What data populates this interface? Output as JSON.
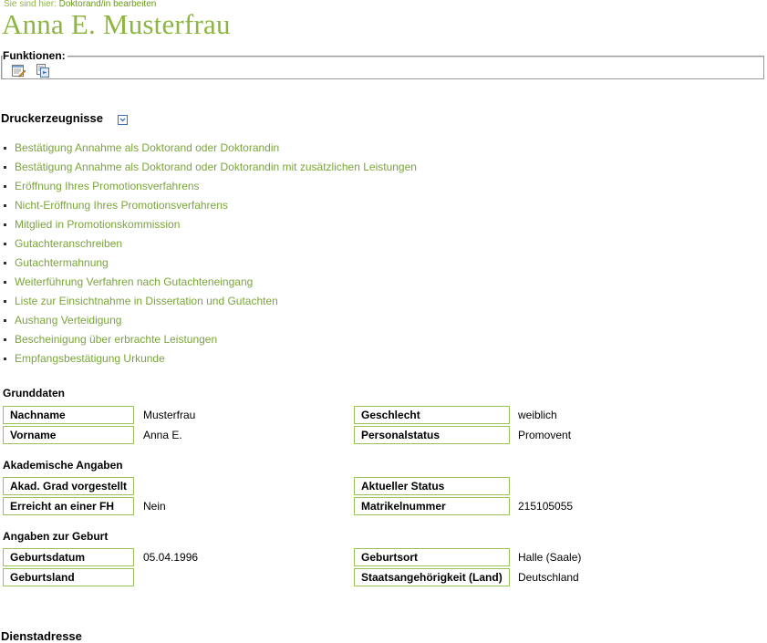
{
  "breadcrumb": {
    "prefix": "Sie sind hier:",
    "current": "Doktorand/in bearbeiten"
  },
  "page_title": "Anna E. Musterfrau",
  "functions": {
    "label": "Funktionen:",
    "icons": [
      "edit-document-icon",
      "document-view-icon"
    ]
  },
  "prints": {
    "title": "Druckerzeugnisse",
    "toggle_icon": "chevron-down-icon",
    "items": [
      "Bestätigung Annahme als Doktorand oder Doktorandin",
      "Bestätigung Annahme als Doktorand oder Doktorandin mit zusätzlichen Leistungen",
      "Eröffnung Ihres Promotionsverfahrens",
      "Nicht-Eröffnung Ihres Promotionsverfahrens",
      "Mitglied in Promotionskommission",
      "Gutachteranschreiben",
      "Gutachtermahnung",
      "Weiterführung Verfahren nach Gutachteneingang",
      "Liste zur Einsichtnahme in Dissertation und Gutachten",
      "Aushang Verteidigung",
      "Bescheinigung über erbrachte Leistungen",
      "Empfangsbestätigung Urkunde"
    ]
  },
  "grunddaten": {
    "title": "Grunddaten",
    "nachname": {
      "label": "Nachname",
      "value": "Musterfrau"
    },
    "geschlecht": {
      "label": "Geschlecht",
      "value": "weiblich"
    },
    "vorname": {
      "label": "Vorname",
      "value": "Anna E."
    },
    "personalstatus": {
      "label": "Personalstatus",
      "value": "Promovent"
    }
  },
  "akademisch": {
    "title": "Akademische Angaben",
    "grad": {
      "label": "Akad. Grad vorgestellt",
      "value": ""
    },
    "status": {
      "label": "Aktueller Status",
      "value": ""
    },
    "fh": {
      "label": "Erreicht an einer FH",
      "value": "Nein"
    },
    "matrikel": {
      "label": "Matrikelnummer",
      "value": "215105055"
    }
  },
  "geburt": {
    "title": "Angaben zur Geburt",
    "datum": {
      "label": "Geburtsdatum",
      "value": "05.04.1996"
    },
    "ort": {
      "label": "Geburtsort",
      "value": "Halle (Saale)"
    },
    "land": {
      "label": "Geburtsland",
      "value": ""
    },
    "staat": {
      "label": "Staatsangehörigkeit (Land)",
      "value": "Deutschland"
    }
  },
  "dienstadresse": {
    "title": "Dienstadresse"
  },
  "colors": {
    "accent": "#8db640",
    "link": "#7aa53a",
    "border": "#9ac25a"
  }
}
